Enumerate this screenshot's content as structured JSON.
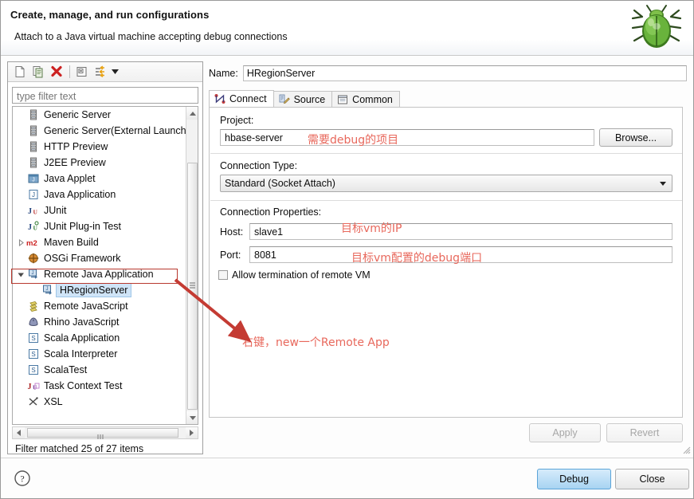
{
  "header": {
    "title": "Create, manage, and run configurations",
    "subtitle": "Attach to a Java virtual machine accepting debug connections",
    "icon": "green-bug-icon"
  },
  "toolbar": {
    "buttons": [
      {
        "name": "new-configuration-icon",
        "tooltip": "New launch configuration"
      },
      {
        "name": "duplicate-configuration-icon",
        "tooltip": "Duplicate currently selected launch configuration"
      },
      {
        "name": "delete-configuration-icon",
        "tooltip": "Delete selected launch configuration(s)"
      },
      {
        "name": "collapse-all-icon",
        "tooltip": "Collapse All"
      },
      {
        "name": "filter-icon",
        "tooltip": "Filter launch configurations"
      }
    ],
    "dropdown_arrow": "chevron-down-icon"
  },
  "filter": {
    "placeholder": "type filter text",
    "value": "",
    "status": "Filter matched 25 of 27 items"
  },
  "tree": {
    "items": [
      {
        "label": "Generic Server",
        "icon": "server-icon",
        "indent": 0,
        "twisty": "",
        "selected": false
      },
      {
        "label": "Generic Server(External Launch",
        "icon": "server-icon",
        "indent": 0,
        "twisty": "",
        "selected": false
      },
      {
        "label": "HTTP Preview",
        "icon": "server-icon",
        "indent": 0,
        "twisty": "",
        "selected": false
      },
      {
        "label": "J2EE Preview",
        "icon": "server-icon",
        "indent": 0,
        "twisty": "",
        "selected": false
      },
      {
        "label": "Java Applet",
        "icon": "java-applet-icon",
        "indent": 0,
        "twisty": "",
        "selected": false
      },
      {
        "label": "Java Application",
        "icon": "java-application-icon",
        "indent": 0,
        "twisty": "",
        "selected": false
      },
      {
        "label": "JUnit",
        "icon": "junit-icon",
        "indent": 0,
        "twisty": "",
        "selected": false
      },
      {
        "label": "JUnit Plug-in Test",
        "icon": "junit-plugin-icon",
        "indent": 0,
        "twisty": "",
        "selected": false
      },
      {
        "label": "Maven Build",
        "icon": "maven-icon",
        "indent": 0,
        "twisty": "collapsed",
        "selected": false
      },
      {
        "label": "OSGi Framework",
        "icon": "osgi-icon",
        "indent": 0,
        "twisty": "",
        "selected": false
      },
      {
        "label": "Remote Java Application",
        "icon": "remote-java-icon",
        "indent": 0,
        "twisty": "expanded",
        "selected": false
      },
      {
        "label": "HRegionServer",
        "icon": "remote-java-icon",
        "indent": 1,
        "twisty": "",
        "selected": true
      },
      {
        "label": "Remote JavaScript",
        "icon": "remote-javascript-icon",
        "indent": 0,
        "twisty": "",
        "selected": false
      },
      {
        "label": "Rhino JavaScript",
        "icon": "rhino-icon",
        "indent": 0,
        "twisty": "",
        "selected": false
      },
      {
        "label": "Scala Application",
        "icon": "scala-icon",
        "indent": 0,
        "twisty": "",
        "selected": false
      },
      {
        "label": "Scala Interpreter",
        "icon": "scala-icon",
        "indent": 0,
        "twisty": "",
        "selected": false
      },
      {
        "label": "ScalaTest",
        "icon": "scala-icon",
        "indent": 0,
        "twisty": "",
        "selected": false
      },
      {
        "label": "Task Context Test",
        "icon": "junit-task-icon",
        "indent": 0,
        "twisty": "",
        "selected": false
      },
      {
        "label": "XSL",
        "icon": "xsl-icon",
        "indent": 0,
        "twisty": "",
        "selected": false
      }
    ]
  },
  "config": {
    "name_label": "Name:",
    "name_value": "HRegionServer",
    "tabs": [
      {
        "label": "Connect",
        "icon": "connect-icon",
        "active": true
      },
      {
        "label": "Source",
        "icon": "source-icon",
        "active": false
      },
      {
        "label": "Common",
        "icon": "common-icon",
        "active": false
      }
    ],
    "project_label": "Project:",
    "project_value": "hbase-server",
    "browse_label": "Browse...",
    "connection_type_label": "Connection Type:",
    "connection_type_value": "Standard (Socket Attach)",
    "connection_properties_label": "Connection Properties:",
    "host_label": "Host:",
    "host_value": "slave1",
    "port_label": "Port:",
    "port_value": "8081",
    "allow_termination_label": "Allow termination of remote VM",
    "allow_termination_checked": false,
    "apply_label": "Apply",
    "revert_label": "Revert"
  },
  "annotations": {
    "project_note": "需要debug的项目",
    "host_note": "目标vm的IP",
    "port_note": "目标vm配置的debug端口",
    "new_app_note": "右键，new一个Remote App",
    "color": "#e8685c",
    "box_color": "#b8392f"
  },
  "footer": {
    "help_icon": "help-icon",
    "debug_label": "Debug",
    "close_label": "Close"
  }
}
